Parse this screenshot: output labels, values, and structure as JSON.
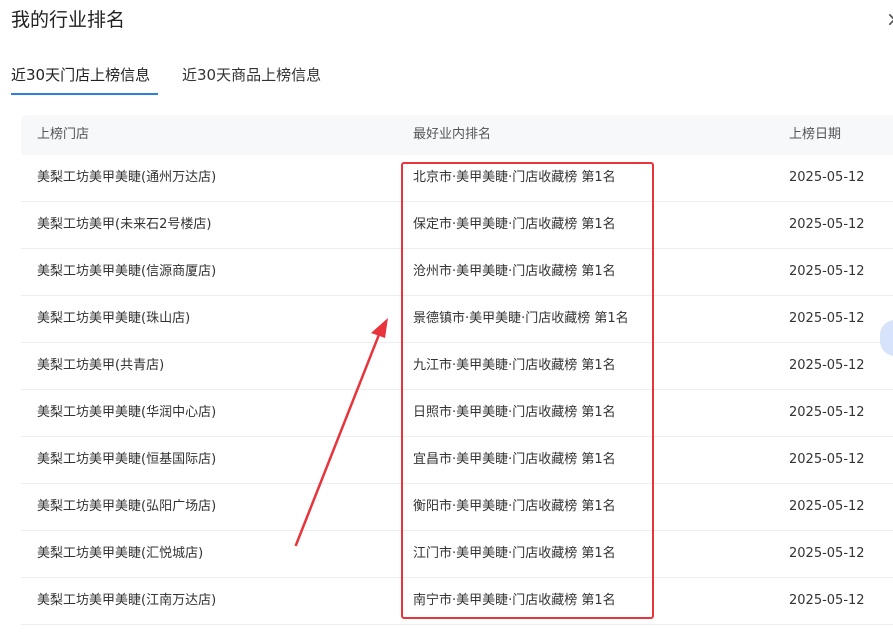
{
  "dialog": {
    "title": "我的行业排名",
    "close_glyph": "×"
  },
  "tabs": [
    {
      "label": "近30天门店上榜信息",
      "active": true
    },
    {
      "label": "近30天商品上榜信息",
      "active": false
    }
  ],
  "table": {
    "headers": [
      "上榜门店",
      "最好业内排名",
      "上榜日期"
    ],
    "rows": [
      {
        "store": "美梨工坊美甲美睫(通州万达店)",
        "rank": "北京市·美甲美睫·门店收藏榜 第1名",
        "date": "2025-05-12"
      },
      {
        "store": "美梨工坊美甲(未来石2号楼店)",
        "rank": "保定市·美甲美睫·门店收藏榜 第1名",
        "date": "2025-05-12"
      },
      {
        "store": "美梨工坊美甲美睫(信源商厦店)",
        "rank": "沧州市·美甲美睫·门店收藏榜 第1名",
        "date": "2025-05-12"
      },
      {
        "store": "美梨工坊美甲美睫(珠山店)",
        "rank": "景德镇市·美甲美睫·门店收藏榜 第1名",
        "date": "2025-05-12"
      },
      {
        "store": "美梨工坊美甲(共青店)",
        "rank": "九江市·美甲美睫·门店收藏榜 第1名",
        "date": "2025-05-12"
      },
      {
        "store": "美梨工坊美甲美睫(华润中心店)",
        "rank": "日照市·美甲美睫·门店收藏榜 第1名",
        "date": "2025-05-12"
      },
      {
        "store": "美梨工坊美甲美睫(恒基国际店)",
        "rank": "宜昌市·美甲美睫·门店收藏榜 第1名",
        "date": "2025-05-12"
      },
      {
        "store": "美梨工坊美甲美睫(弘阳广场店)",
        "rank": "衡阳市·美甲美睫·门店收藏榜 第1名",
        "date": "2025-05-12"
      },
      {
        "store": "美梨工坊美甲美睫(汇悦城店)",
        "rank": "江门市·美甲美睫·门店收藏榜 第1名",
        "date": "2025-05-12"
      },
      {
        "store": "美梨工坊美甲美睫(江南万达店)",
        "rank": "南宁市·美甲美睫·门店收藏榜 第1名",
        "date": "2025-05-12"
      }
    ]
  },
  "colors": {
    "tab_active_underline": "#2f7fe0",
    "annotation_red": "#e8343b",
    "header_bg": "#f7f8fa"
  }
}
